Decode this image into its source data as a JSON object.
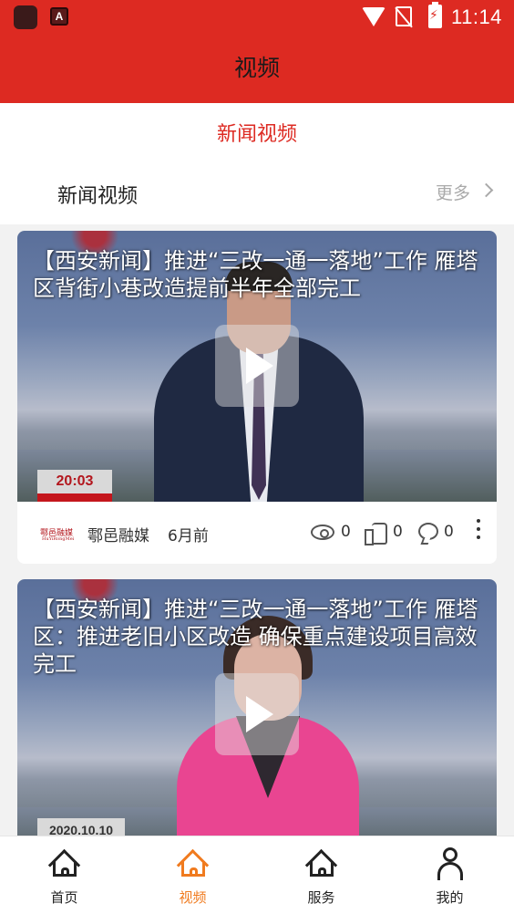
{
  "status_bar": {
    "time": "11:14",
    "app_badge_letter": "A"
  },
  "header": {
    "title": "视频"
  },
  "channel_tab": {
    "label": "新闻视频"
  },
  "section": {
    "title": "新闻视频",
    "more_label": "更多"
  },
  "videos": [
    {
      "title": "【西安新闻】推进“三改一通一落地”工作 雁塔区背街小巷改造提前半年全部完工",
      "thumb_tag": "20:03",
      "source": "鄠邑融媒",
      "time_ago": "6月前",
      "views": "0",
      "likes": "0",
      "comments": "0"
    },
    {
      "title": "【西安新闻】推进“三改一通一落地”工作 雁塔区：推进老旧小区改造 确保重点建设项目高效完工",
      "thumb_tag": "2020.10.10"
    }
  ],
  "source_logo": {
    "cn": "鄠邑融媒",
    "en": "HuYiRongMei"
  },
  "bottom_nav": [
    {
      "label": "首页",
      "icon": "home-icon",
      "active": false
    },
    {
      "label": "视频",
      "icon": "home-icon",
      "active": true
    },
    {
      "label": "服务",
      "icon": "home-icon",
      "active": false
    },
    {
      "label": "我的",
      "icon": "user-icon",
      "active": false
    }
  ],
  "colors": {
    "brand_red": "#dd2a22",
    "active_orange": "#f07b1f"
  }
}
